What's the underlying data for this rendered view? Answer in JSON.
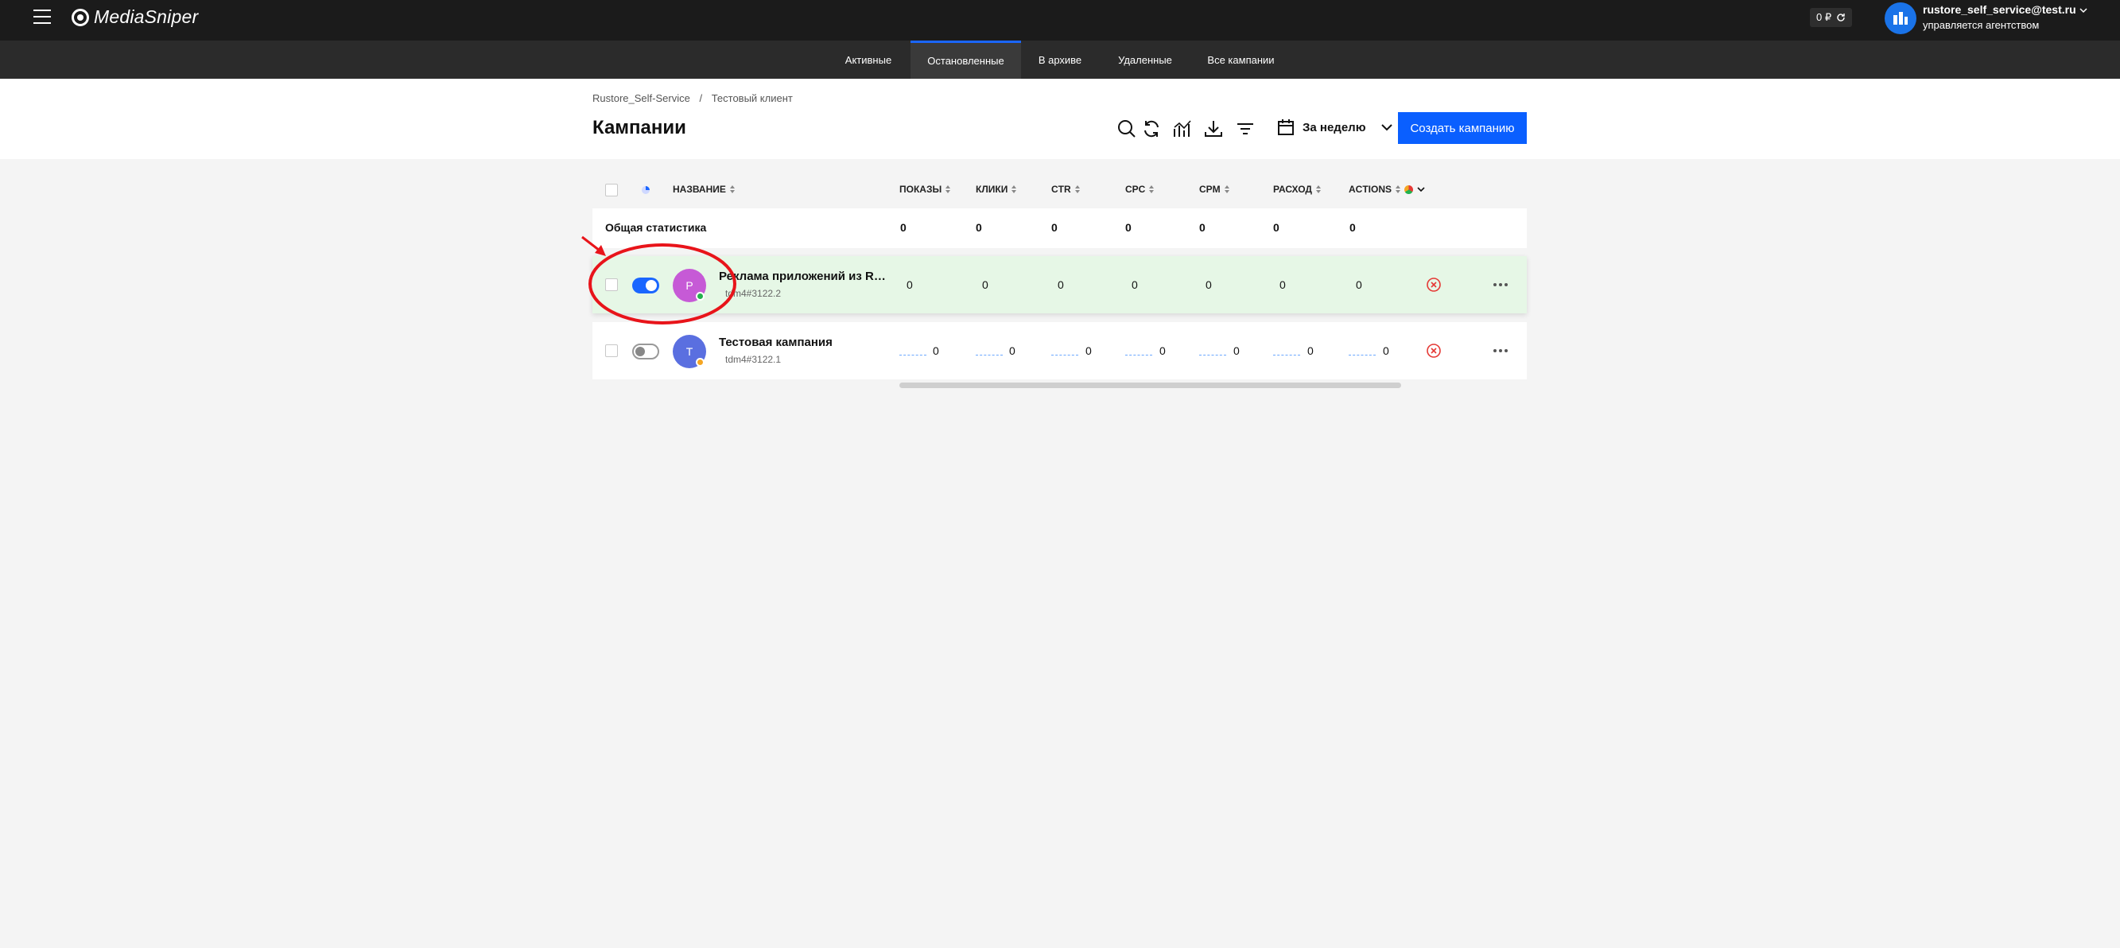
{
  "app": {
    "logo": "MediaSniper"
  },
  "topbar": {
    "balance": "0 ₽",
    "user_email": "rustore_self_service@test.ru",
    "user_subtitle": "управляется агентством"
  },
  "tabs": [
    {
      "label": "Активные"
    },
    {
      "label": "Остановленные",
      "active": true
    },
    {
      "label": "В архиве"
    },
    {
      "label": "Удаленные"
    },
    {
      "label": "Все кампании"
    }
  ],
  "breadcrumb": {
    "root": "Rustore_Self-Service",
    "separator": "/",
    "current": "Тестовый клиент"
  },
  "page_title": "Кампании",
  "toolbar": {
    "icons": [
      "search-icon",
      "refresh-icon",
      "chart-icon",
      "download-icon",
      "filter-icon"
    ],
    "period_label": "За неделю",
    "create_label": "Создать кампанию"
  },
  "columns": {
    "name": "НАЗВАНИЕ",
    "impressions": "ПОКАЗЫ",
    "clicks": "КЛИКИ",
    "ctr": "CTR",
    "cpc": "CPC",
    "cpm": "CPM",
    "spend": "РАСХОД",
    "actions": "ACTIONS"
  },
  "totals": {
    "label": "Общая статистика",
    "impressions": "0",
    "clicks": "0",
    "ctr": "0",
    "cpc": "0",
    "cpm": "0",
    "spend": "0",
    "actions": "0"
  },
  "rows": [
    {
      "avatar": "P",
      "avatar_color": "#c65ad6",
      "status_color": "#22b14c",
      "name": "Реклама приложений из RuStore",
      "id": "tdm4#3122.2",
      "enabled": true,
      "impressions": "0",
      "clicks": "0",
      "ctr": "0",
      "cpc": "0",
      "cpm": "0",
      "spend": "0",
      "actions": "0"
    },
    {
      "avatar": "T",
      "avatar_color": "#5a6fe0",
      "status_color": "#f5a623",
      "name": "Тестовая кампания",
      "id": "tdm4#3122.1",
      "enabled": false,
      "impressions": "0",
      "clicks": "0",
      "ctr": "0",
      "cpc": "0",
      "cpm": "0",
      "spend": "0",
      "actions": "0"
    }
  ],
  "colors": {
    "accent": "#0a5fff",
    "annotation": "#e8141a",
    "error": "#e53935"
  }
}
